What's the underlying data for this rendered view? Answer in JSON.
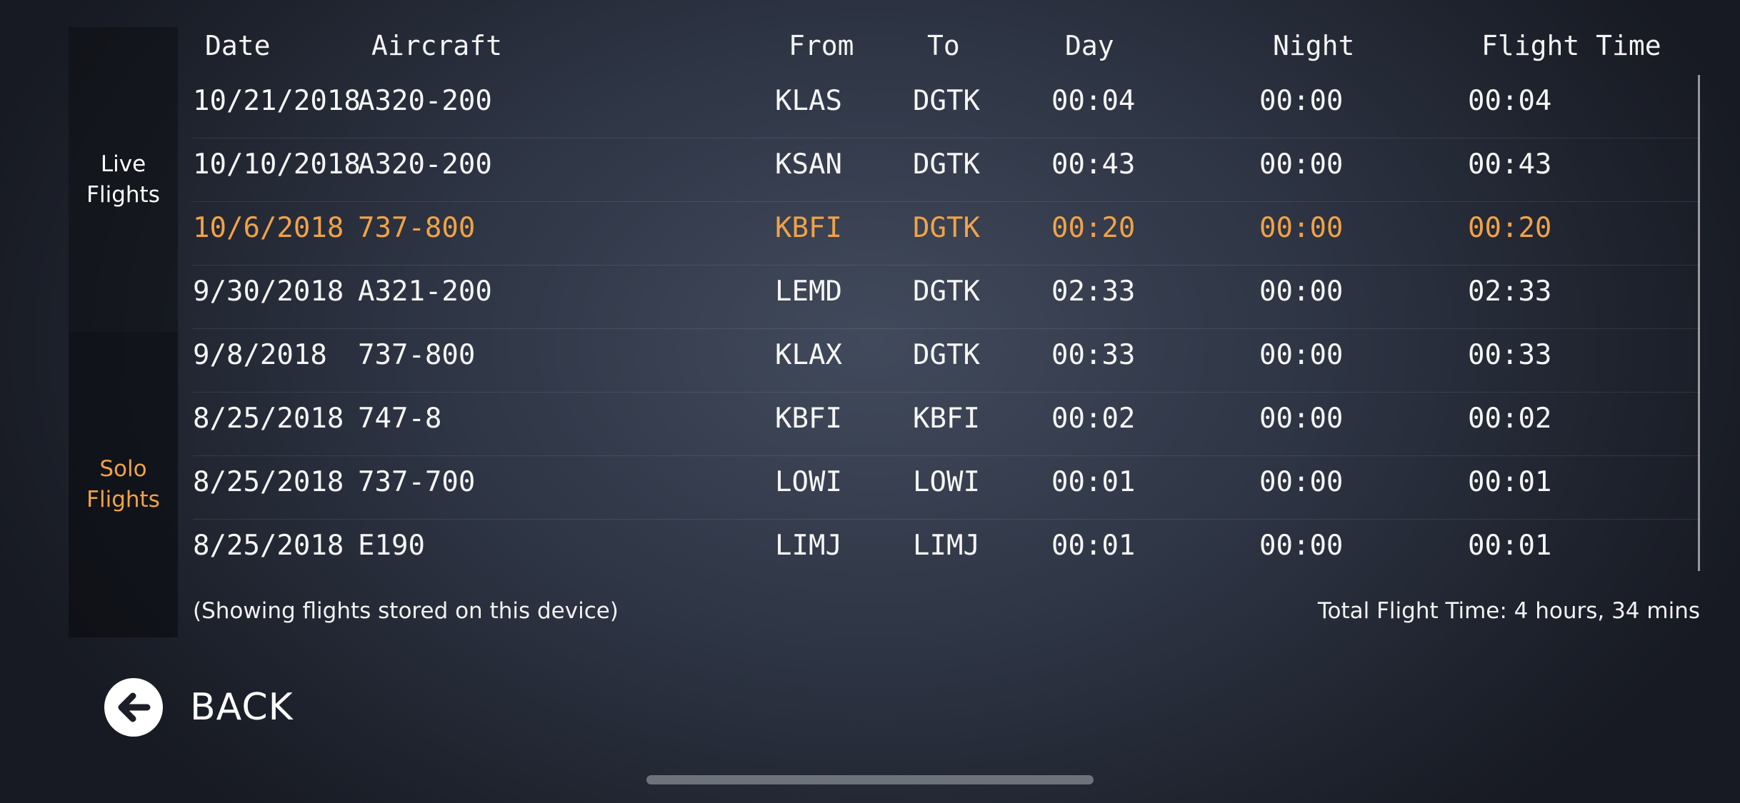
{
  "sidebar": {
    "tabs": [
      {
        "label": "Live Flights",
        "active": false
      },
      {
        "label": "Solo Flights",
        "active": true,
        "color": "#f0a247"
      }
    ]
  },
  "table": {
    "columns": [
      "Date",
      "Aircraft",
      "From",
      "To",
      "Day",
      "Night",
      "Flight Time"
    ],
    "rows": [
      {
        "date": "10/21/2018",
        "aircraft": "A320-200",
        "from": "KLAS",
        "to": "DGTK",
        "day": "00:04",
        "night": "00:00",
        "flight_time": "00:04"
      },
      {
        "date": "10/10/2018",
        "aircraft": "A320-200",
        "from": "KSAN",
        "to": "DGTK",
        "day": "00:43",
        "night": "00:00",
        "flight_time": "00:43"
      },
      {
        "date": "10/6/2018",
        "aircraft": "737-800",
        "from": "KBFI",
        "to": "DGTK",
        "day": "00:20",
        "night": "00:00",
        "flight_time": "00:20",
        "highlighted": true
      },
      {
        "date": "9/30/2018",
        "aircraft": "A321-200",
        "from": "LEMD",
        "to": "DGTK",
        "day": "02:33",
        "night": "00:00",
        "flight_time": "02:33"
      },
      {
        "date": "9/8/2018",
        "aircraft": "737-800",
        "from": "KLAX",
        "to": "DGTK",
        "day": "00:33",
        "night": "00:00",
        "flight_time": "00:33"
      },
      {
        "date": "8/25/2018",
        "aircraft": "747-8",
        "from": "KBFI",
        "to": "KBFI",
        "day": "00:02",
        "night": "00:00",
        "flight_time": "00:02"
      },
      {
        "date": "8/25/2018",
        "aircraft": "737-700",
        "from": "LOWI",
        "to": "LOWI",
        "day": "00:01",
        "night": "00:00",
        "flight_time": "00:01"
      },
      {
        "date": "8/25/2018",
        "aircraft": "E190",
        "from": "LIMJ",
        "to": "LIMJ",
        "day": "00:01",
        "night": "00:00",
        "flight_time": "00:01"
      }
    ],
    "highlight_color": "#f0a247"
  },
  "footer": {
    "note": "(Showing flights stored on this device)",
    "total": "Total Flight Time: 4 hours, 34 mins"
  },
  "back_button": {
    "label": "BACK",
    "icon": "arrow-left-circle-icon"
  }
}
